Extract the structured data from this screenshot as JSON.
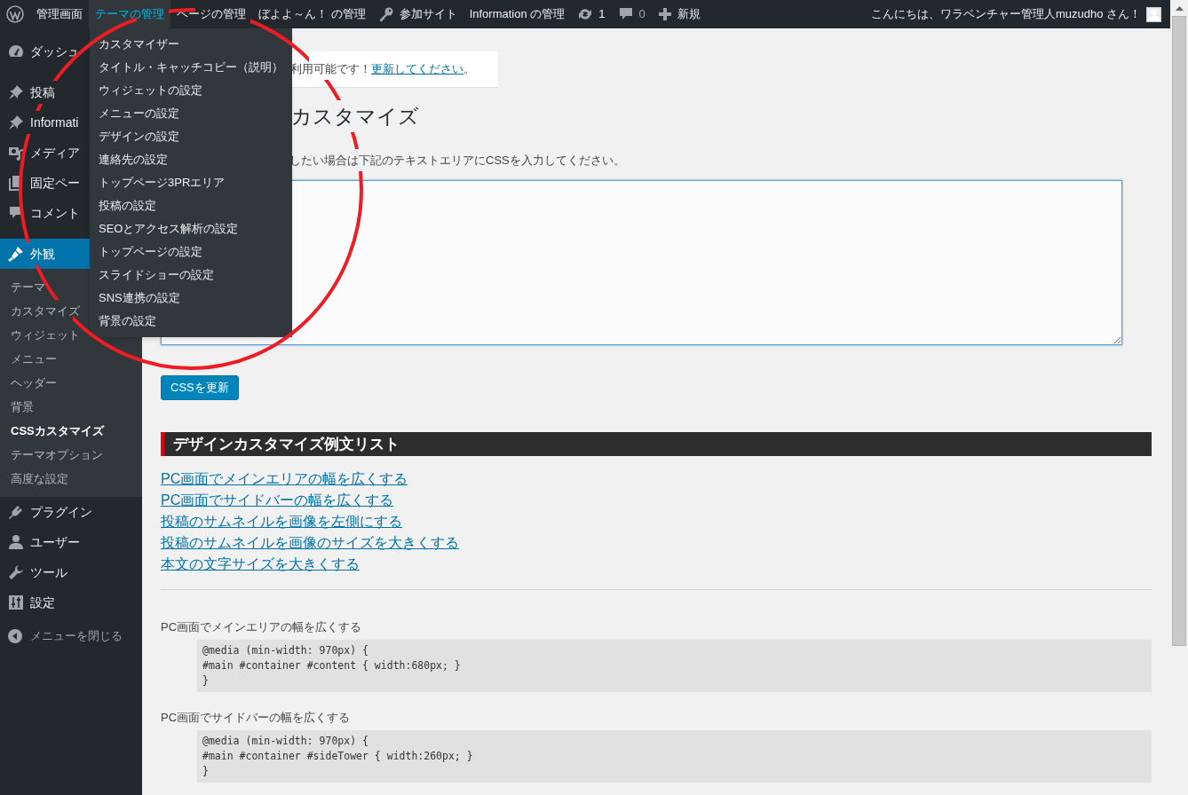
{
  "admin_bar": {
    "items": [
      {
        "kind": "logo",
        "selected": false
      },
      {
        "kind": "text",
        "label": "管理画面",
        "selected": false
      },
      {
        "kind": "text",
        "label": "テーマの管理",
        "selected": true
      },
      {
        "kind": "text",
        "label": "ページの管理",
        "selected": false
      },
      {
        "kind": "text",
        "label": "ぼよよ～ん！ の管理",
        "selected": false
      },
      {
        "kind": "key",
        "label": "参加サイト",
        "selected": false
      },
      {
        "kind": "text",
        "label": "Information の管理",
        "selected": false
      },
      {
        "kind": "updates",
        "label": "1",
        "selected": false
      },
      {
        "kind": "comments",
        "label": "0",
        "selected": false
      },
      {
        "kind": "new",
        "label": "新規",
        "selected": false
      }
    ],
    "greeting": "こんにちは、ワラベンチャー管理人muzudho さん！"
  },
  "dropdown": {
    "items": [
      "カスタマイザー",
      "タイトル・キャッチコピー（説明）",
      "ウィジェットの設定",
      "メニューの設定",
      "デザインの設定",
      "連絡先の設定",
      "トップページ3PRエリア",
      "投稿の設定",
      "SEOとアクセス解析の設定",
      "トップページの設定",
      "スライドショーの設定",
      "SNS連携の設定",
      "背景の設定"
    ]
  },
  "sidebar": {
    "groups": [
      [
        {
          "kind": "dashboard",
          "label": "ダッシュ",
          "selected": false
        }
      ],
      [
        {
          "kind": "pin",
          "label": "投稿",
          "selected": false
        },
        {
          "kind": "pin",
          "label": "Informati",
          "selected": false
        },
        {
          "kind": "media",
          "label": "メディア",
          "selected": false
        },
        {
          "kind": "pages",
          "label": "固定ペー",
          "selected": false
        },
        {
          "kind": "comments",
          "label": "コメント",
          "selected": false
        }
      ],
      [
        {
          "kind": "brush",
          "label": "外観",
          "selected": true,
          "children": [
            {
              "label": "テーマ",
              "selected": false
            },
            {
              "label": "カスタマイズ",
              "selected": false
            },
            {
              "label": "ウィジェット",
              "selected": false
            },
            {
              "label": "メニュー",
              "selected": false
            },
            {
              "label": "ヘッダー",
              "selected": false
            },
            {
              "label": "背景",
              "selected": false
            },
            {
              "label": "CSSカスタマイズ",
              "selected": true
            },
            {
              "label": "テーマオプション",
              "selected": false
            },
            {
              "label": "高度な設定",
              "selected": false
            }
          ]
        },
        {
          "kind": "plugin",
          "label": "プラグイン",
          "selected": false
        },
        {
          "kind": "user",
          "label": "ユーザー",
          "selected": false
        },
        {
          "kind": "tool",
          "label": "ツール",
          "selected": false
        },
        {
          "kind": "settings",
          "label": "設定",
          "selected": false
        }
      ]
    ],
    "collapse": "メニューを閉じる"
  },
  "main": {
    "notice": {
      "text": "利用可能です！",
      "link": "更新してください",
      "tail": "。"
    },
    "heading": "カスタマイズ",
    "description": "したい場合は下記のテキストエリアにCSSを入力してください。",
    "button": "CSSを更新",
    "section_title": "デザインカスタマイズ例文リスト",
    "links": [
      "PC画面でメインエリアの幅を広くする",
      "PC画面でサイドバーの幅を広くする",
      "投稿のサムネイルを画像を左側にする",
      "投稿のサムネイルを画像のサイズを大きくする",
      "本文の文字サイズを大きくする"
    ],
    "examples": [
      {
        "title": "PC画面でメインエリアの幅を広くする",
        "lines": [
          "@media (min-width: 970px) {",
          "#main #container #content { width:680px; }",
          "}"
        ]
      },
      {
        "title": "PC画面でサイドバーの幅を広くする",
        "lines": [
          "@media (min-width: 970px) {",
          "#main #container #sideTower { width:260px; }",
          "}"
        ]
      }
    ]
  }
}
